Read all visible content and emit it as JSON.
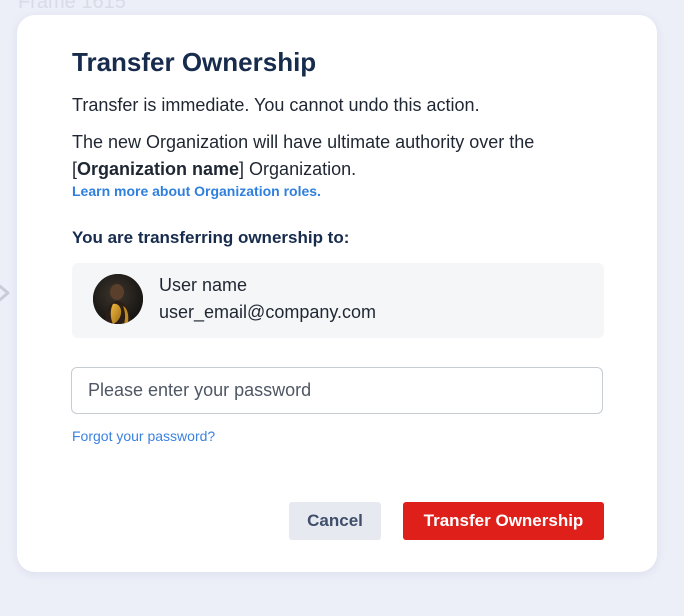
{
  "background": {
    "frame_label": "Frame 1615",
    "arrow_icon": "chevron-right-icon"
  },
  "dialog": {
    "title": "Transfer Ownership",
    "warning_text": "Transfer is immediate. You cannot undo this action.",
    "authority_text_before": "The new Organization will have ultimate authority over the [",
    "authority_org_name": "Organization name",
    "authority_text_after": "] Organization.",
    "learn_more_link": "Learn more about Organization roles.",
    "transfer_to_label": "You are transferring ownership to:",
    "recipient": {
      "name": "User name",
      "email": "user_email@company.com",
      "avatar_icon": "user-avatar-photo"
    },
    "password": {
      "placeholder": "Please enter your password",
      "value": ""
    },
    "forgot_password_link": "Forgot your password?",
    "cancel_label": "Cancel",
    "confirm_label": "Transfer Ownership"
  },
  "colors": {
    "page_background": "#eceef8",
    "title": "#172b4d",
    "link": "#2f7fdd",
    "danger_button": "#de1f1a",
    "secondary_button": "#e6e9ef",
    "card_background": "#f5f6f8"
  }
}
